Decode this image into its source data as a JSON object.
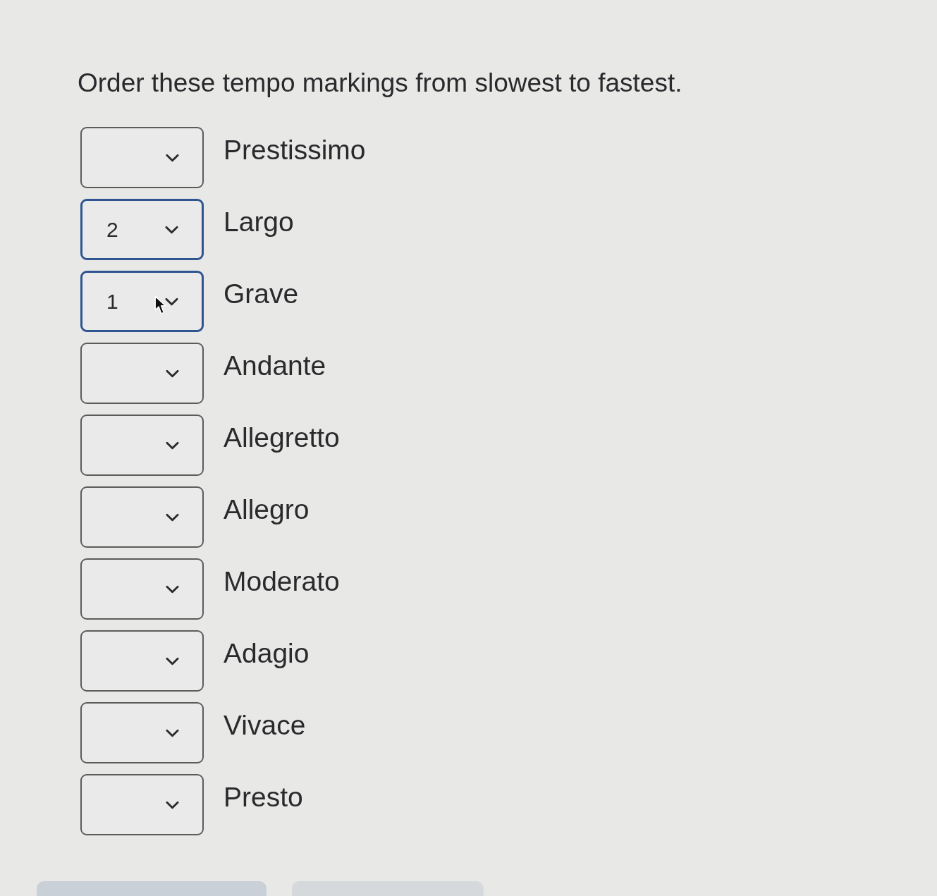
{
  "question": {
    "prompt": "Order these tempo markings from slowest to fastest."
  },
  "items": [
    {
      "label": "Prestissimo",
      "hovered": false
    },
    {
      "label": "Largo",
      "value": "2",
      "hovered": false
    },
    {
      "label": "Grave",
      "value": "1",
      "hovered": true
    },
    {
      "label": "Andante",
      "hovered": false
    },
    {
      "label": "Allegretto",
      "hovered": false
    },
    {
      "label": "Allegro",
      "hovered": false
    },
    {
      "label": "Moderato",
      "hovered": false
    },
    {
      "label": "Adagio",
      "hovered": false
    },
    {
      "label": "Vivace",
      "hovered": false
    },
    {
      "label": "Presto",
      "hovered": false
    }
  ],
  "buttons": [
    {
      "kind": "primary"
    },
    {
      "kind": "secondary"
    }
  ]
}
